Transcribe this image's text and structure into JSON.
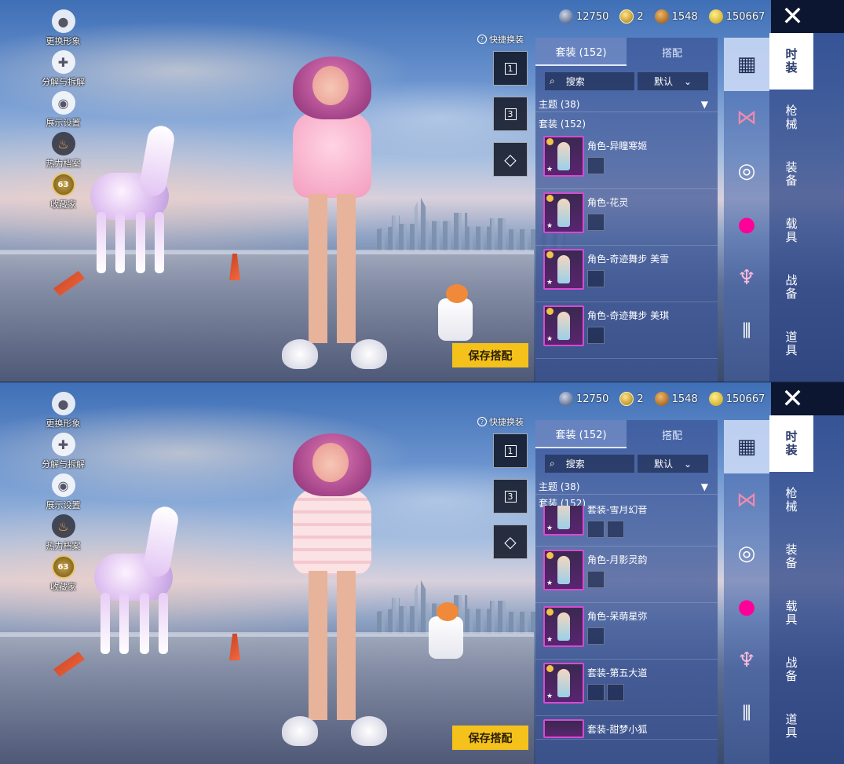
{
  "left_menu": [
    {
      "label": "更换形象",
      "icon": "avatar-icon"
    },
    {
      "label": "分解与拆解",
      "icon": "puzzle-icon"
    },
    {
      "label": "展示设置",
      "icon": "eye-icon"
    },
    {
      "label": "热力档案",
      "icon": "flame-icon"
    },
    {
      "label": "收藏家",
      "icon": "collector-badge-icon",
      "badge": "63"
    }
  ],
  "currency": [
    {
      "name": "uc",
      "value": "12750"
    },
    {
      "name": "ag",
      "value": "2"
    },
    {
      "name": "bp",
      "value": "1548"
    },
    {
      "name": "pt",
      "value": "150667"
    }
  ],
  "quick_change": {
    "label": "快捷换装",
    "slots": [
      "1",
      "3"
    ]
  },
  "tabs": {
    "suits": "套装 (152)",
    "outfits": "搭配"
  },
  "search": {
    "placeholder": "搜索",
    "sort": "默认"
  },
  "theme": {
    "label": "主题 (38)"
  },
  "suit_header": "套装 (152)",
  "save_label": "保存搭配",
  "categories": [
    "时装",
    "枪械",
    "装备",
    "载具",
    "战备",
    "道具"
  ],
  "screen1": {
    "items": [
      "角色-异瞳寒姬",
      "角色-花灵",
      "角色-奇迹舞步 美雪",
      "角色-奇迹舞步 美琪"
    ]
  },
  "screen2": {
    "items_partial_top": "套装-雪月幻音",
    "items": [
      "角色-月影灵韵",
      "角色-呆萌星弥",
      "套装-第五大道"
    ],
    "items_partial_bottom": "套装-甜梦小狐"
  },
  "colors": {
    "accent": "#f5c21c",
    "panel": "#3c5596",
    "highlight": "#d64bd2"
  }
}
